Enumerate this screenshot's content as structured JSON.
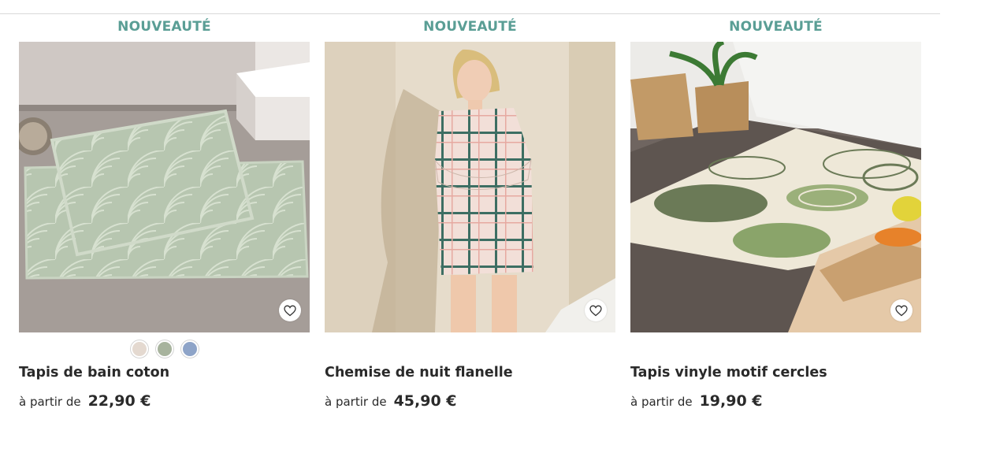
{
  "products": [
    {
      "badge": "NOUVEAUTÉ",
      "title": "Tapis de bain coton",
      "price_prefix": "à partir de",
      "price": "22,90 €",
      "favorite_icon": "heart-outline-icon",
      "swatches": [
        {
          "color": "#e4d9d0"
        },
        {
          "color": "#a7b39d"
        },
        {
          "color": "#8ea4c8"
        }
      ]
    },
    {
      "badge": "NOUVEAUTÉ",
      "title": "Chemise de nuit flanelle",
      "price_prefix": "à partir de",
      "price": "45,90 €",
      "favorite_icon": "heart-outline-icon"
    },
    {
      "badge": "NOUVEAUTÉ",
      "title": "Tapis vinyle motif cercles",
      "price_prefix": "à partir de",
      "price": "19,90 €",
      "favorite_icon": "heart-outline-icon"
    }
  ],
  "colors": {
    "badge": "#5a9e95",
    "text": "#2a2a2a"
  }
}
